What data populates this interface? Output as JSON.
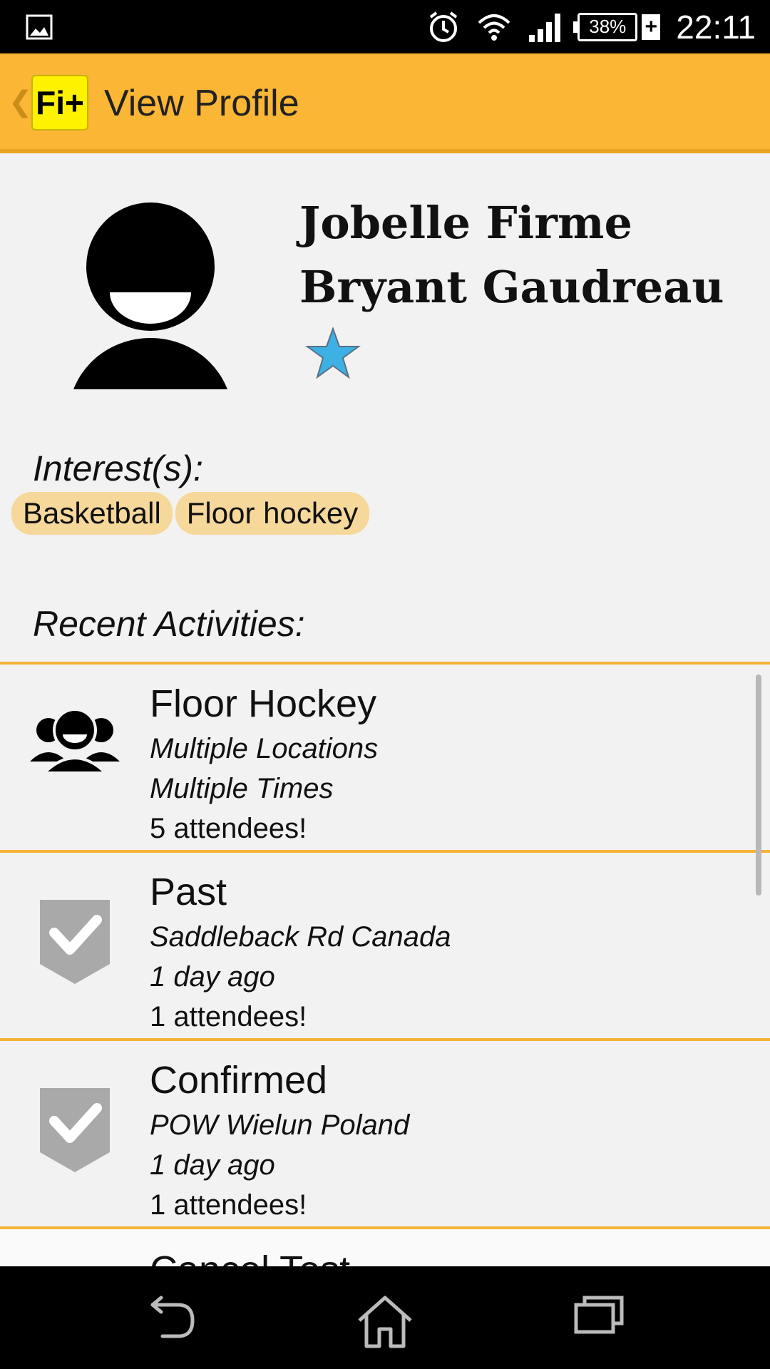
{
  "status_bar": {
    "time": "22:11",
    "battery": "38%"
  },
  "action_bar": {
    "title": "View Profile",
    "logo": "Fi+"
  },
  "profile": {
    "name_line1": "Jobelle Firme",
    "name_line2": "Bryant Gaudreau",
    "star_color": "#3db0e4"
  },
  "interests": {
    "label": "Interest(s):",
    "items": [
      "Basketball",
      "Floor hockey"
    ]
  },
  "recent": {
    "label": "Recent Activities:",
    "items": [
      {
        "title": "Floor Hockey",
        "location": "Multiple Locations",
        "when": "Multiple Times",
        "attendees": "5 attendees!",
        "icon": "group-icon"
      },
      {
        "title": "Past",
        "location": "Saddleback Rd  Canada",
        "when": "1 day ago",
        "attendees": "1 attendees!",
        "icon": "check-shield-icon"
      },
      {
        "title": "Confirmed",
        "location": "POW Wielun Poland",
        "when": "1 day ago",
        "attendees": "1 attendees!",
        "icon": "check-shield-icon"
      },
      {
        "title": "Cancel Test",
        "icon": ""
      }
    ]
  },
  "colors": {
    "accent": "#fbb635",
    "divider": "#f4b336",
    "chip": "#f5d89a"
  }
}
